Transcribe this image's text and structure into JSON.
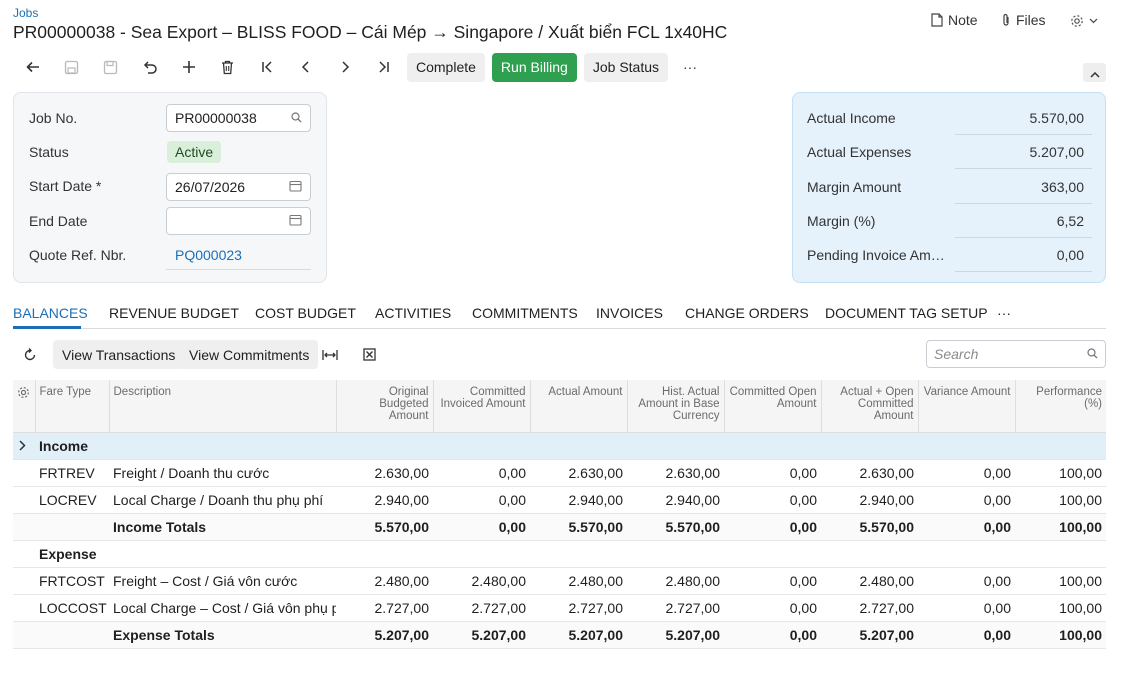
{
  "breadcrumb": "Jobs",
  "title": "PR00000038 - Sea Export – BLISS FOOD – Cái Mép → Singapore / Xuất biển FCL 1x40HC",
  "header_links": {
    "note": "Note",
    "files": "Files"
  },
  "toolbar": {
    "complete": "Complete",
    "run_billing": "Run Billing",
    "job_status": "Job Status",
    "more": "···"
  },
  "form": {
    "job_no_label": "Job No.",
    "job_no_value": "PR00000038",
    "status_label": "Status",
    "status_value": "Active",
    "start_date_label": "Start Date *",
    "start_date_value": "26/07/2026",
    "end_date_label": "End Date",
    "end_date_value": "",
    "quote_label": "Quote Ref. Nbr.",
    "quote_value": "PQ000023"
  },
  "totals": [
    {
      "label": "Actual Income",
      "value": "5.570,00"
    },
    {
      "label": "Actual Expenses",
      "value": "5.207,00"
    },
    {
      "label": "Margin Amount",
      "value": "363,00"
    },
    {
      "label": "Margin (%)",
      "value": "6,52"
    },
    {
      "label": "Pending Invoice Am…",
      "value": "0,00"
    }
  ],
  "tabs": [
    "BALANCES",
    "REVENUE BUDGET",
    "COST BUDGET",
    "ACTIVITIES",
    "COMMITMENTS",
    "INVOICES",
    "CHANGE ORDERS",
    "DOCUMENT TAG SETUP",
    "···"
  ],
  "grid_toolbar": {
    "view_transactions": "View Transactions",
    "view_commitments": "View Commitments",
    "search_placeholder": "Search"
  },
  "columns": {
    "fare_type": "Fare Type",
    "description": "Description",
    "original_budgeted": "Original Budgeted Amount",
    "committed_invoiced": "Committed Invoiced Amount",
    "actual_amount": "Actual Amount",
    "hist_actual": "Hist. Actual Amount in Base Currency",
    "committed_open": "Committed Open Amount",
    "actual_open_committed": "Actual + Open Committed Amount",
    "variance": "Variance Amount",
    "performance": "Performance (%)"
  },
  "groups": {
    "income": {
      "label": "Income",
      "rows": [
        {
          "fare": "FRTREV",
          "desc": "Freight / Doanh thu cước",
          "v": [
            "2.630,00",
            "0,00",
            "2.630,00",
            "2.630,00",
            "0,00",
            "2.630,00",
            "0,00",
            "100,00"
          ]
        },
        {
          "fare": "LOCREV",
          "desc": "Local Charge / Doanh thu phụ phí",
          "v": [
            "2.940,00",
            "0,00",
            "2.940,00",
            "2.940,00",
            "0,00",
            "2.940,00",
            "0,00",
            "100,00"
          ]
        }
      ],
      "total_label": "Income Totals",
      "total": [
        "5.570,00",
        "0,00",
        "5.570,00",
        "5.570,00",
        "0,00",
        "5.570,00",
        "0,00",
        "100,00"
      ]
    },
    "expense": {
      "label": "Expense",
      "rows": [
        {
          "fare": "FRTCOST",
          "desc": "Freight – Cost / Giá vôn cước",
          "v": [
            "2.480,00",
            "2.480,00",
            "2.480,00",
            "2.480,00",
            "0,00",
            "2.480,00",
            "0,00",
            "100,00"
          ]
        },
        {
          "fare": "LOCCOST",
          "desc": "Local Charge – Cost / Giá vôn phụ phí",
          "v": [
            "2.727,00",
            "2.727,00",
            "2.727,00",
            "2.727,00",
            "0,00",
            "2.727,00",
            "0,00",
            "100,00"
          ]
        }
      ],
      "total_label": "Expense Totals",
      "total": [
        "5.207,00",
        "5.207,00",
        "5.207,00",
        "5.207,00",
        "0,00",
        "5.207,00",
        "0,00",
        "100,00"
      ]
    }
  },
  "colors": {
    "accent": "#1a6fb6",
    "primary_button": "#2ea04f",
    "status_bg": "#d9efd9",
    "totals_bg": "#e5f1fb"
  }
}
